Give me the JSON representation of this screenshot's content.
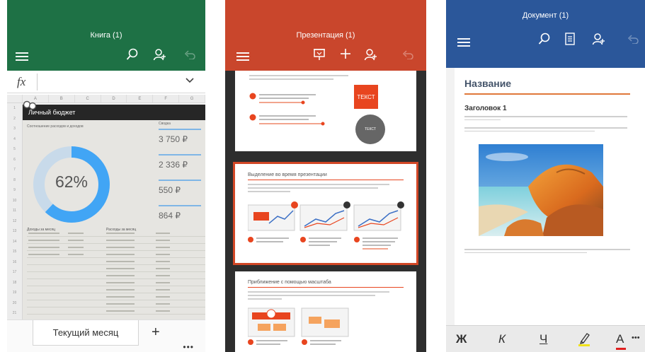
{
  "excel": {
    "title": "Книга (1)",
    "fx": "fx",
    "sheet_title": "Личный бюджет",
    "columns": [
      "A",
      "B",
      "C",
      "D",
      "E",
      "F",
      "G"
    ],
    "rows": [
      "1",
      "2",
      "3",
      "4",
      "5",
      "6",
      "7",
      "8",
      "9",
      "10",
      "11",
      "12",
      "13",
      "14",
      "15",
      "16",
      "17",
      "18",
      "19",
      "20",
      "21"
    ],
    "chart_caption": "Соотношение расходов и доходов",
    "percent": "62%",
    "side_caption": "Сводка",
    "amounts": [
      "3 750 ₽",
      "2 336 ₽",
      "550 ₽",
      "864 ₽"
    ],
    "income_caption": "Доходы за месяц",
    "expenses_caption": "Расходы за месяц",
    "tab_active": "Текущий месяц",
    "tab_add": "+",
    "more": "•••",
    "colors": {
      "header": "#1e7145",
      "donut": "#41a5f5",
      "donut_track": "#c8daea"
    }
  },
  "ppt": {
    "title": "Презентация (1)",
    "slide1_box": "ТЕКСТ",
    "slide1_circle": "ТЕКСТ",
    "slide2_title": "Выделение во время презентации",
    "slide3_title": "Приближение с помощью масштаба",
    "colors": {
      "header": "#c9462c",
      "accent": "#e8451f"
    }
  },
  "word": {
    "title": "Документ (1)",
    "doc_title": "Название",
    "heading1": "Заголовок 1",
    "toolbar": {
      "bold": "Ж",
      "italic": "К",
      "underline": "Ч",
      "highlight": "highlighter-icon",
      "font_color": "А",
      "more": "•••"
    },
    "colors": {
      "header": "#2b579a",
      "rule": "#e0783a"
    }
  }
}
